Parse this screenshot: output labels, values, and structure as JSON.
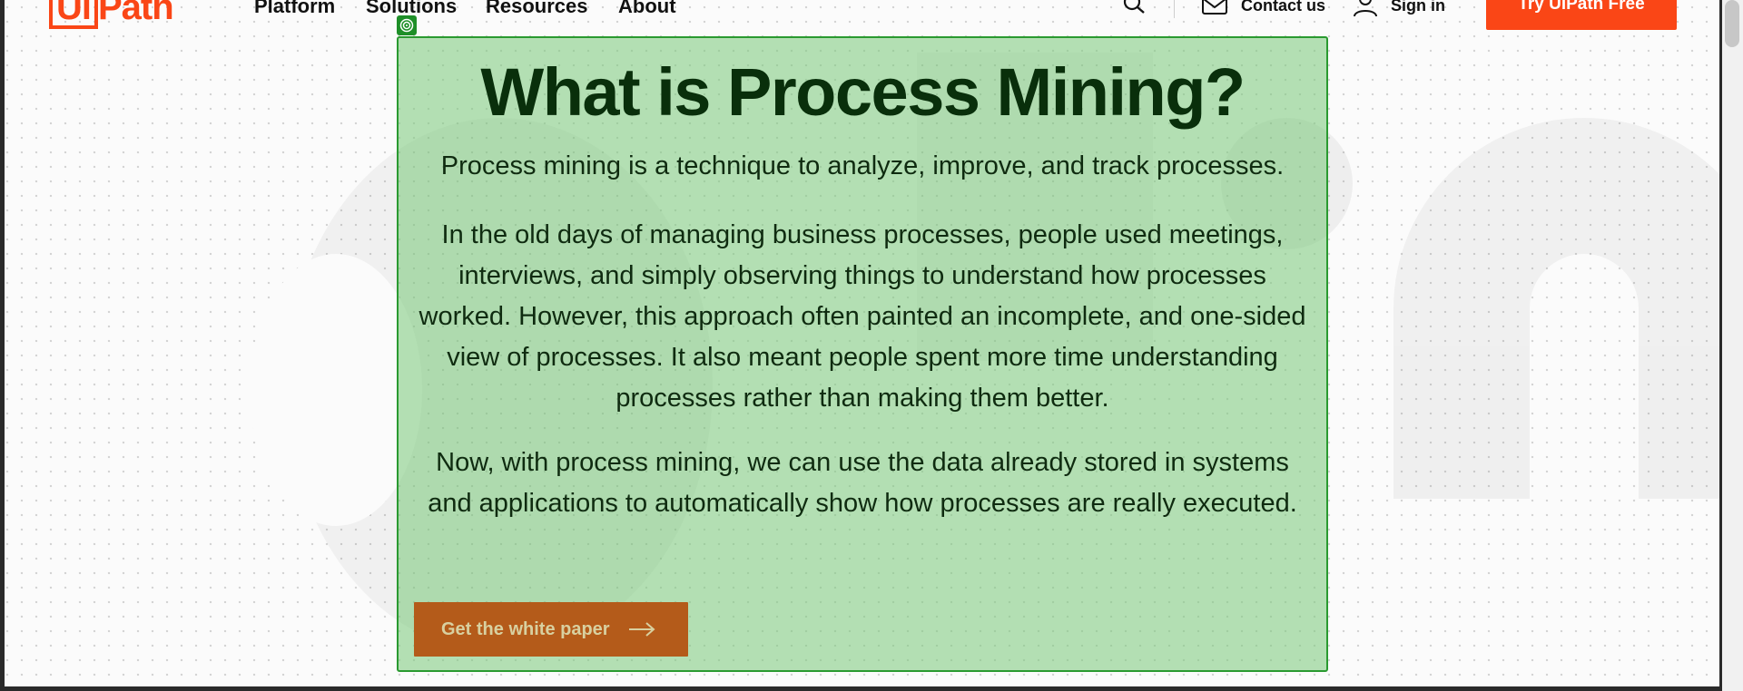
{
  "header": {
    "logo_text_a": "Ui",
    "logo_text_b": "Path",
    "nav": [
      {
        "label": "Platform"
      },
      {
        "label": "Solutions"
      },
      {
        "label": "Resources"
      },
      {
        "label": "About"
      }
    ],
    "contact_label": "Contact us",
    "signin_label": "Sign in",
    "try_button_label": "Try UiPath Free"
  },
  "panel": {
    "title": "What is Process Mining?",
    "intro": "Process mining is a technique to analyze, improve, and track processes.",
    "paragraph_old": "In the old days of managing business processes, people used meetings, interviews, and simply observing things to understand how processes worked. However, this approach often painted an incomplete, and one-sided view of processes. It also meant people spent more time understanding processes rather than making them better.",
    "paragraph_now": "Now, with process mining, we can use the data already stored in systems and applications to automatically show how processes are really executed.",
    "cta_label": "Get the white paper"
  },
  "colors": {
    "brand": "#fa4616",
    "panel_bg": "#b2dbb0",
    "panel_border": "#2a9a30",
    "cta_bg": "#b45b1a",
    "title_color": "#092f0b"
  },
  "icons": [
    "search-icon",
    "mail-icon",
    "user-icon",
    "arrow-right-icon",
    "target-icon"
  ]
}
